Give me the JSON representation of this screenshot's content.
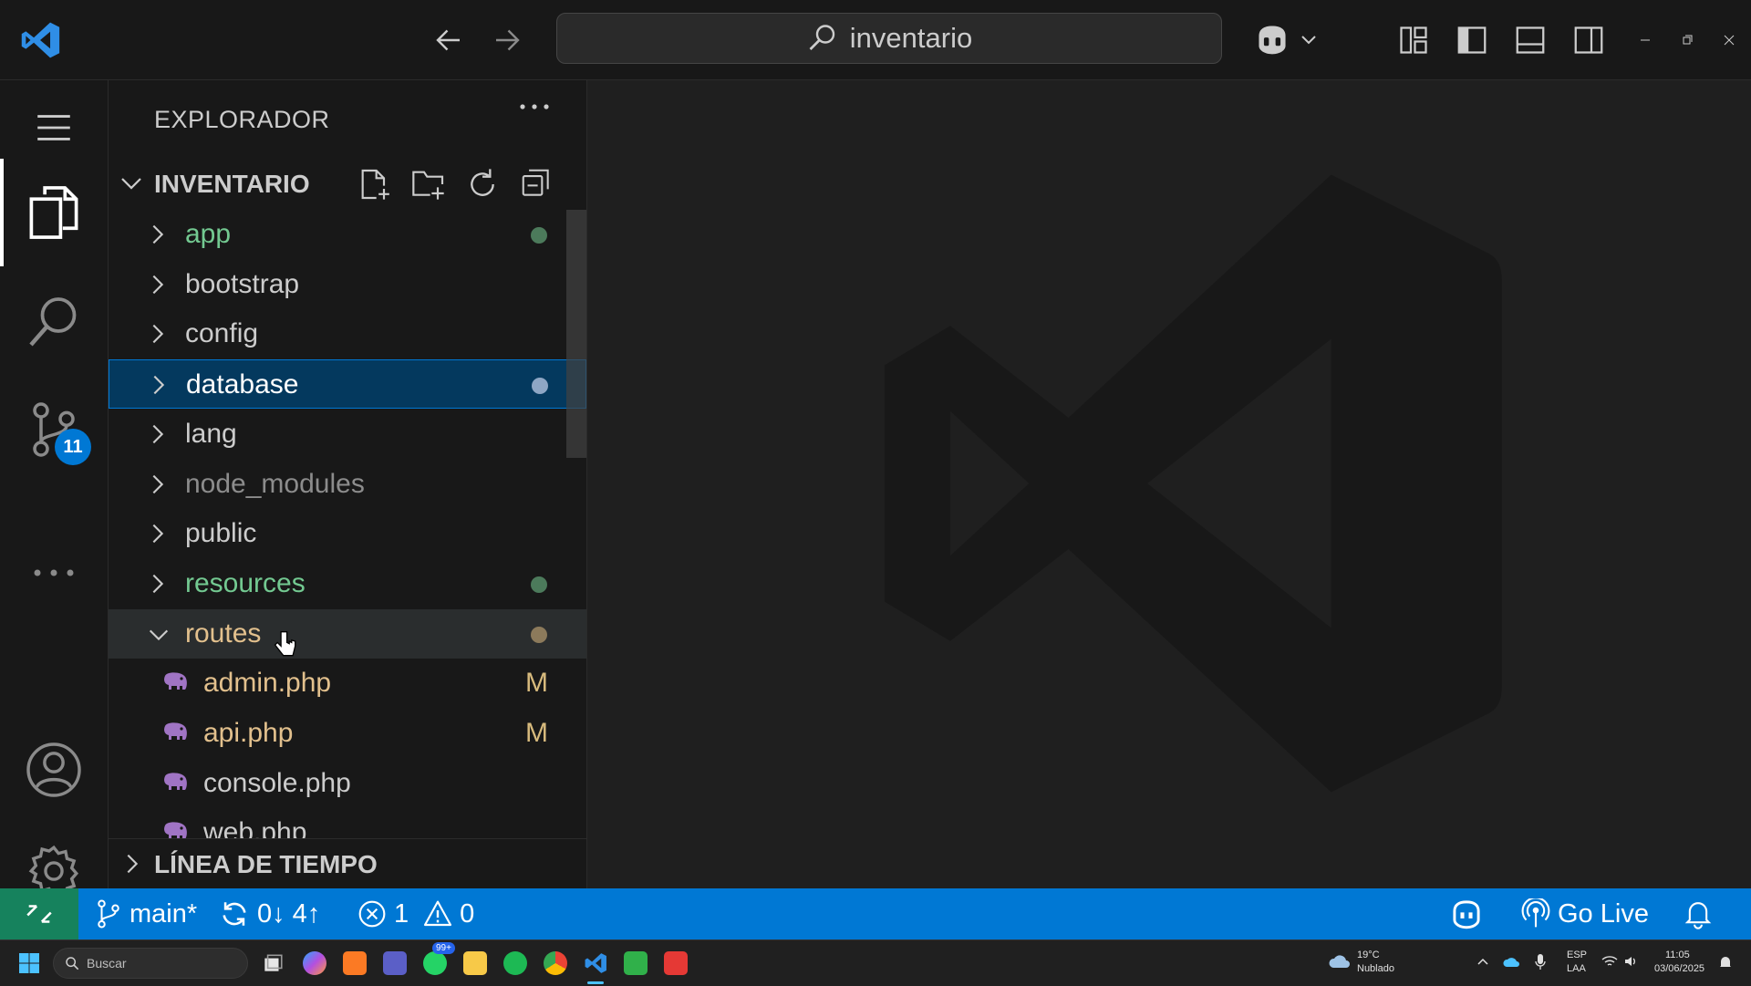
{
  "titlebar": {
    "search_text": "inventario"
  },
  "activitybar": {
    "scm_badge": "11"
  },
  "explorer": {
    "title": "EXPLORADOR",
    "section_title": "INVENTARIO",
    "timeline_title": "LÍNEA DE TIEMPO",
    "items": [
      {
        "label": "app",
        "type": "folder",
        "color": "#73c991",
        "dot": "#4c7a5b"
      },
      {
        "label": "bootstrap",
        "type": "folder",
        "color": "#cccccc"
      },
      {
        "label": "config",
        "type": "folder",
        "color": "#cccccc"
      },
      {
        "label": "database",
        "type": "folder",
        "color": "#ffffff",
        "dot": "#8ea6c4",
        "selected": true
      },
      {
        "label": "lang",
        "type": "folder",
        "color": "#cccccc"
      },
      {
        "label": "node_modules",
        "type": "folder",
        "color": "#8c8c8c"
      },
      {
        "label": "public",
        "type": "folder",
        "color": "#cccccc"
      },
      {
        "label": "resources",
        "type": "folder",
        "color": "#73c991",
        "dot": "#4c7a5b"
      },
      {
        "label": "routes",
        "type": "folder-open",
        "color": "#e2c08d",
        "dot": "#8c7a5b",
        "hover": true
      },
      {
        "label": "admin.php",
        "type": "file",
        "color": "#e2c08d",
        "status": "M"
      },
      {
        "label": "api.php",
        "type": "file",
        "color": "#e2c08d",
        "status": "M"
      },
      {
        "label": "console.php",
        "type": "file",
        "color": "#cccccc"
      },
      {
        "label": "web.php",
        "type": "file",
        "color": "#cccccc"
      }
    ]
  },
  "statusbar": {
    "branch": "main*",
    "sync": "0↓ 4↑",
    "errors": "1",
    "warnings": "0",
    "go_live": "Go Live"
  },
  "taskbar": {
    "search_placeholder": "Buscar",
    "weather_temp": "19°C",
    "weather_desc": "Nublado",
    "lang_top": "ESP",
    "lang_bottom": "LAA",
    "time": "11:05",
    "date": "03/06/2025",
    "whatsapp_badge": "99+"
  }
}
